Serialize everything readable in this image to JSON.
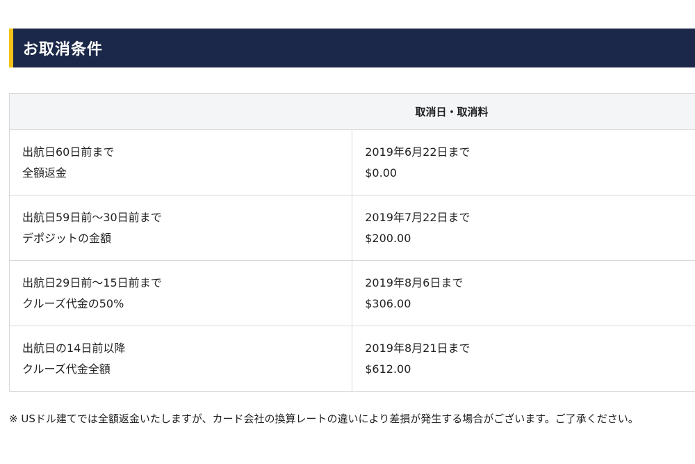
{
  "section": {
    "title": "お取消条件"
  },
  "table": {
    "header": "取消日・取消料",
    "rows": [
      {
        "condition": "出航日60日前まで",
        "refund": "全額返金",
        "date": "2019年6月22日まで",
        "fee": "$0.00"
      },
      {
        "condition": "出航日59日前〜30日前まで",
        "refund": "デポジットの金額",
        "date": "2019年7月22日まで",
        "fee": "$200.00"
      },
      {
        "condition": "出航日29日前〜15日前まで",
        "refund": "クルーズ代金の50%",
        "date": "2019年8月6日まで",
        "fee": "$306.00"
      },
      {
        "condition": "出航日の14日前以降",
        "refund": "クルーズ代金全額",
        "date": "2019年8月21日まで",
        "fee": "$612.00"
      }
    ]
  },
  "footnote": "※ USドル建てでは全額返金いたしますが、カード会社の換算レートの違いにより差損が発生する場合がございます。ご了承ください。",
  "colors": {
    "header_bg": "#1b2849",
    "header_accent": "#f2c21b",
    "table_header_bg": "#f4f5f7",
    "border": "#d8d8d8"
  }
}
